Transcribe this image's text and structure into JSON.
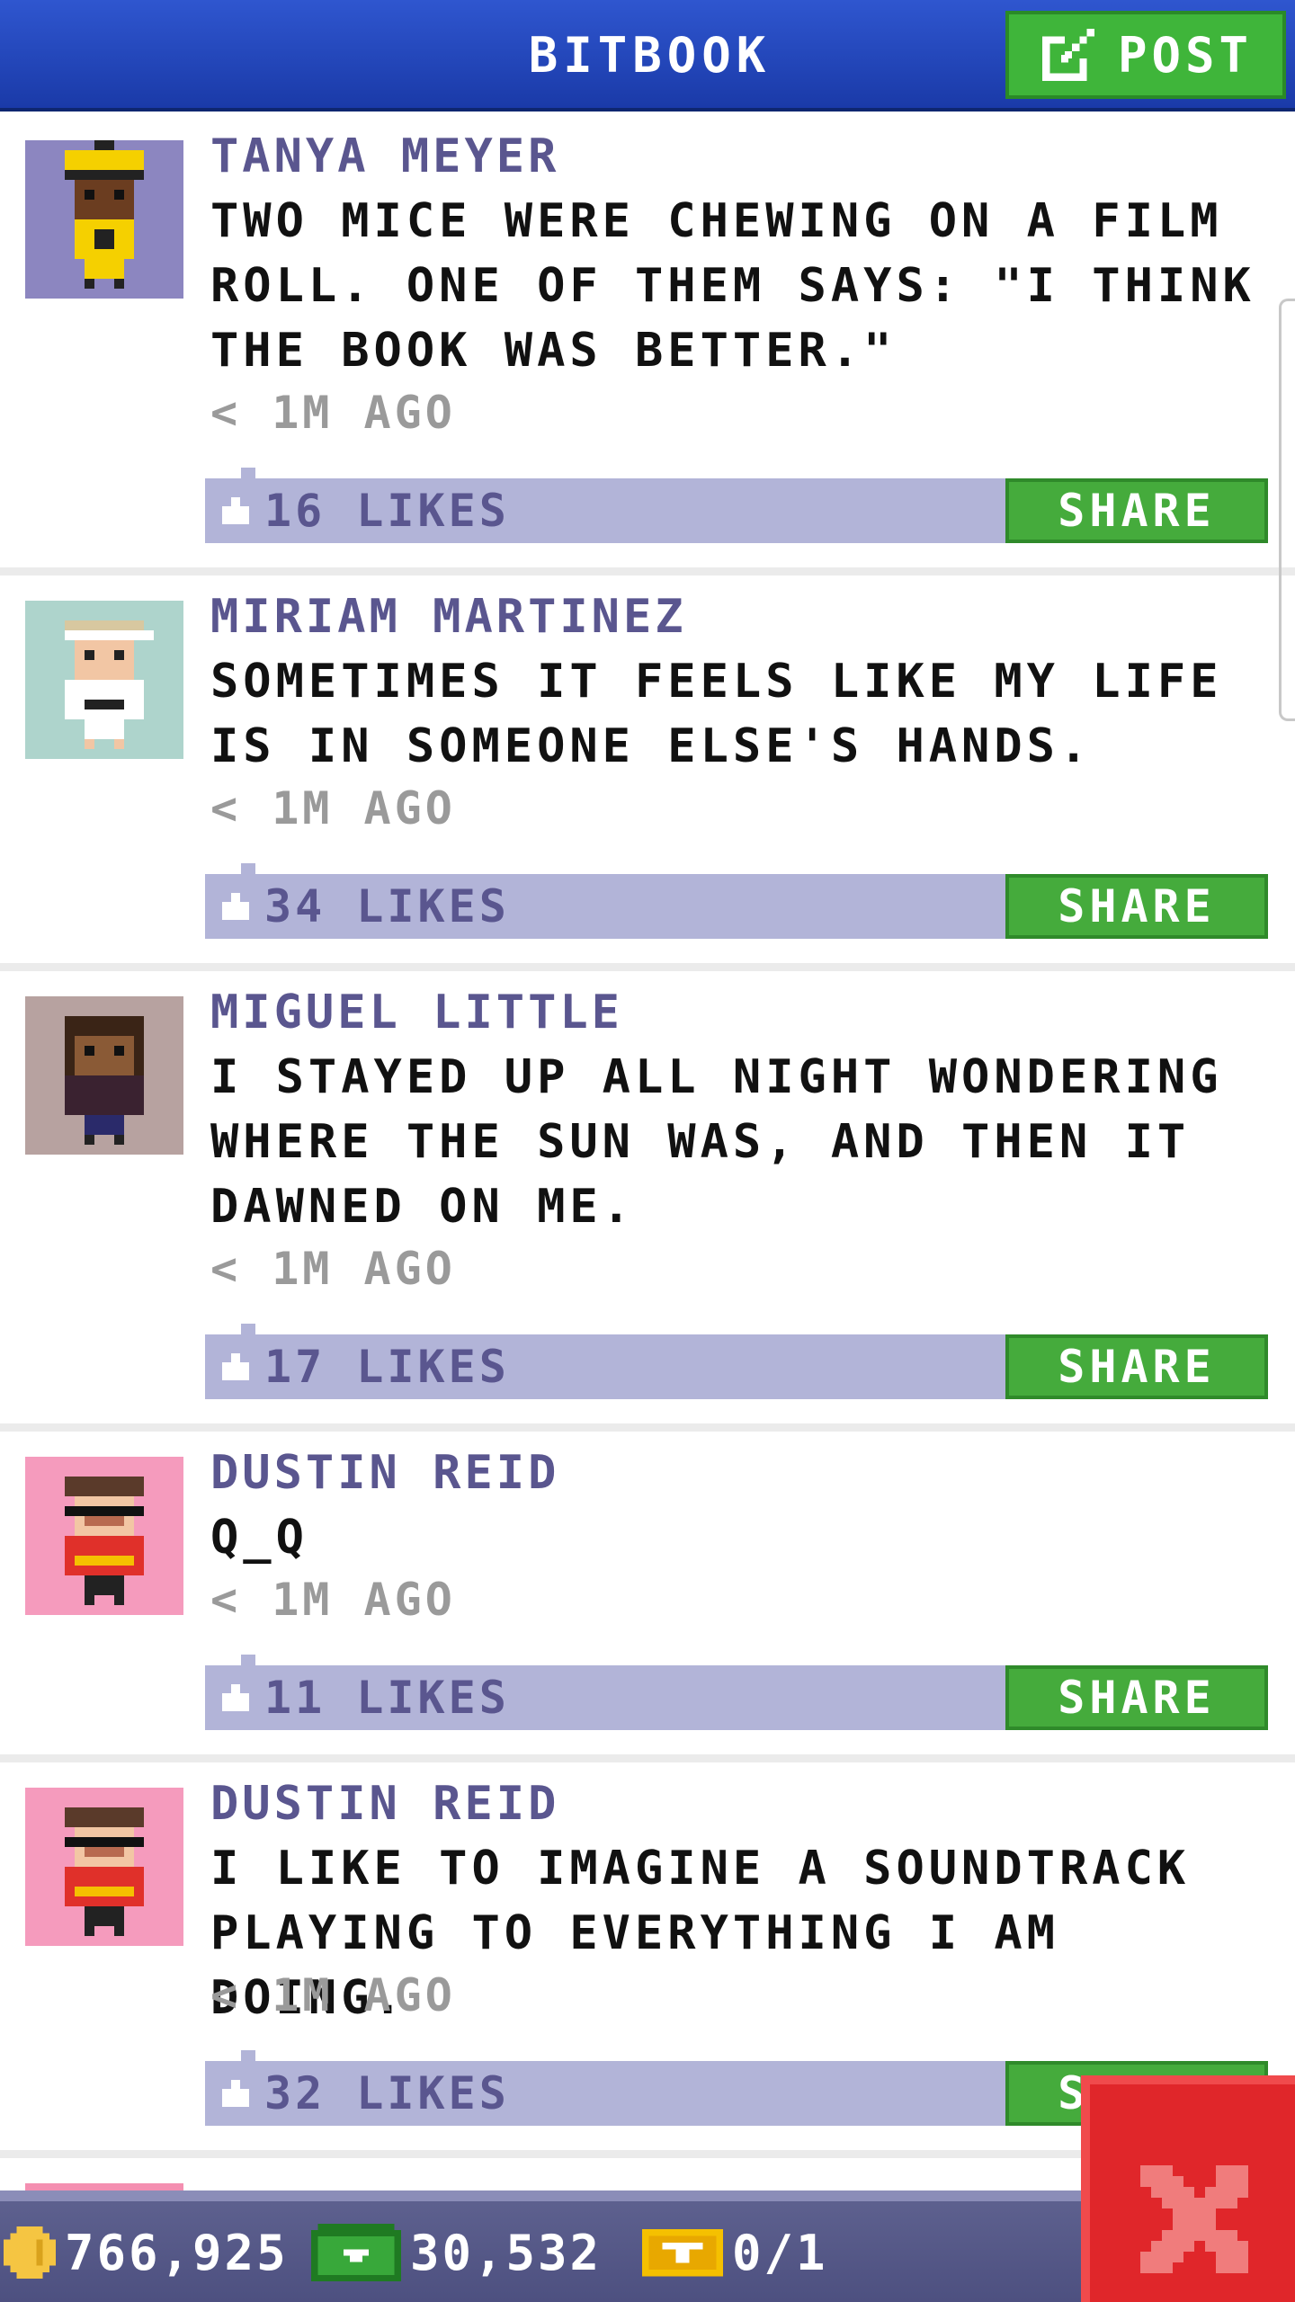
{
  "header": {
    "title": "BITBOOK",
    "post_button": "POST",
    "post_icon": "compose-icon"
  },
  "posts": [
    {
      "name": "TANYA MEYER",
      "text": "TWO MICE WERE CHEWING ON A FILM ROLL. ONE OF THEM SAYS: \"I THINK THE BOOK WAS BETTER.\"",
      "time": "< 1M AGO",
      "likes": "16 LIKES",
      "share": "SHARE",
      "avatar_bg": "#8c86c0"
    },
    {
      "name": "MIRIAM MARTINEZ",
      "text": "SOMETIMES IT FEELS LIKE MY LIFE IS IN SOMEONE ELSE'S HANDS.",
      "time": "< 1M AGO",
      "likes": "34 LIKES",
      "share": "SHARE",
      "avatar_bg": "#aed4cc"
    },
    {
      "name": "MIGUEL LITTLE",
      "text": "I STAYED UP ALL NIGHT WONDERING WHERE THE SUN WAS, AND THEN IT DAWNED ON ME.",
      "time": "< 1M AGO",
      "likes": "17 LIKES",
      "share": "SHARE",
      "avatar_bg": "#b7a2a0"
    },
    {
      "name": "DUSTIN REID",
      "text": "Q_Q",
      "time": "< 1M AGO",
      "likes": "11 LIKES",
      "share": "SHARE",
      "avatar_bg": "#f59bbd"
    },
    {
      "name": "DUSTIN REID",
      "text": "I LIKE TO IMAGINE A SOUNDTRACK PLAYING TO EVERYTHING I AM DOING.",
      "time": "< 1M AGO",
      "likes": "32 LIKES",
      "share": "SHARE",
      "avatar_bg": "#f59bbd"
    }
  ],
  "status": {
    "coins": "766,925",
    "bux": "30,532",
    "tickets": "0/1"
  },
  "colors": {
    "header": "#2147b8",
    "name": "#5a568f",
    "like_bar": "#b2b4d8",
    "share": "#45ab3c",
    "close": "#e0262a"
  }
}
